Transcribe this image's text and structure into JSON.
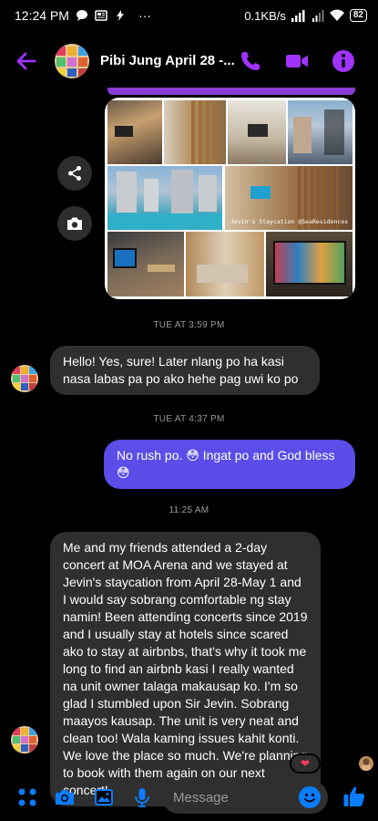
{
  "status_bar": {
    "time": "12:24 PM",
    "dots": "···",
    "network_speed": "0.1KB/s",
    "battery": "82"
  },
  "header": {
    "contact_name": "Pibi Jung April 28 -...",
    "accent": "#a033ff"
  },
  "photo_collage": {
    "watermark": "Jevin's Staycation @SeaResidences"
  },
  "messages": {
    "ts1": "TUE AT 3:59 PM",
    "msg1": "Hello! Yes, sure! Later nlang po ha kasi nasa labas pa po ako hehe pag uwi ko po",
    "ts2": "TUE AT 4:37 PM",
    "msg2": "No rush po. 😳 Ingat po and God bless 😳",
    "ts3": "11:25 AM",
    "msg3": "Me and my friends attended a 2-day concert at MOA Arena and we stayed at Jevin's staycation from April 28-May 1 and I would say sobrang comfortable ng stay namin! Been attending concerts since 2019 and I usually stay at hotels since scared ako to stay at airbnbs, that's why it took me long to find an airbnb kasi I really wanted na unit owner talaga makausap ko. I'm so glad I stumbled upon Sir Jevin. Sobrang maayos kausap. The unit is very neat and clean too! Wala kaming issues kahit konti. We love the place so much. We're planning to book with them again on our next concert!",
    "reaction": "❤"
  },
  "composer": {
    "placeholder": "Message"
  },
  "colors": {
    "outgoing_bubble": "#5b4de8",
    "incoming_bubble": "#2f2f2f",
    "composer_icons": "#0a7cff"
  }
}
